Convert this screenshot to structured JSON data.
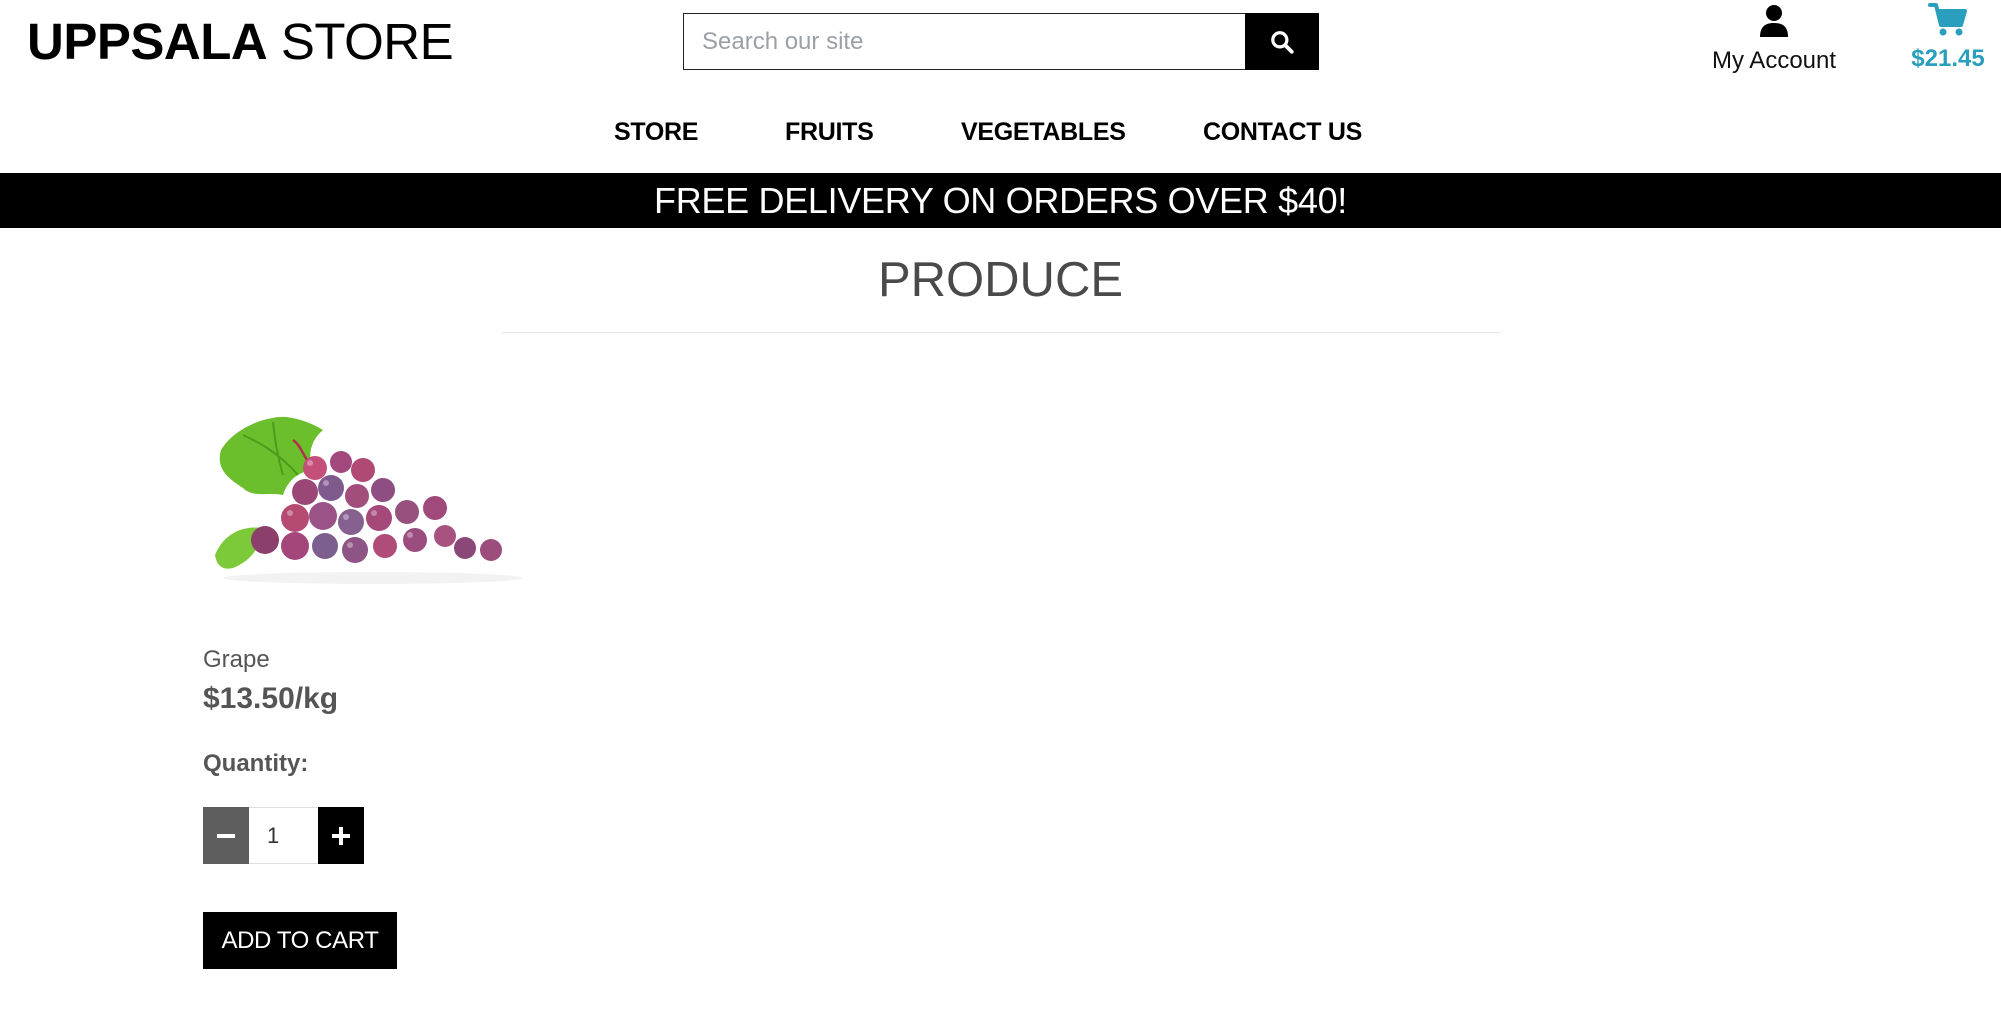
{
  "header": {
    "logo_bold": "UPPSALA",
    "logo_light": "STORE",
    "search": {
      "placeholder": "Search our site",
      "value": ""
    },
    "account_label": "My Account",
    "cart_total": "$21.45"
  },
  "nav": {
    "items": [
      {
        "label": "STORE"
      },
      {
        "label": "FRUITS"
      },
      {
        "label": "VEGETABLES"
      },
      {
        "label": "CONTACT US"
      }
    ]
  },
  "banner": {
    "text": "FREE DELIVERY ON ORDERS OVER $40!"
  },
  "main": {
    "title": "PRODUCE",
    "product": {
      "name": "Grape",
      "price": "$13.50/kg",
      "quantity_label": "Quantity:",
      "quantity_value": "1",
      "add_to_cart_label": "ADD TO CART"
    }
  },
  "icons": {
    "search": "search-icon",
    "account": "user-icon",
    "cart": "shopping-cart-icon",
    "minus": "minus-icon",
    "plus": "plus-icon"
  },
  "colors": {
    "accent": "#2a9fbd",
    "banner_bg": "#000000",
    "minus_button": "#5e5e5e",
    "plus_button": "#000000",
    "text_muted": "#555555"
  }
}
